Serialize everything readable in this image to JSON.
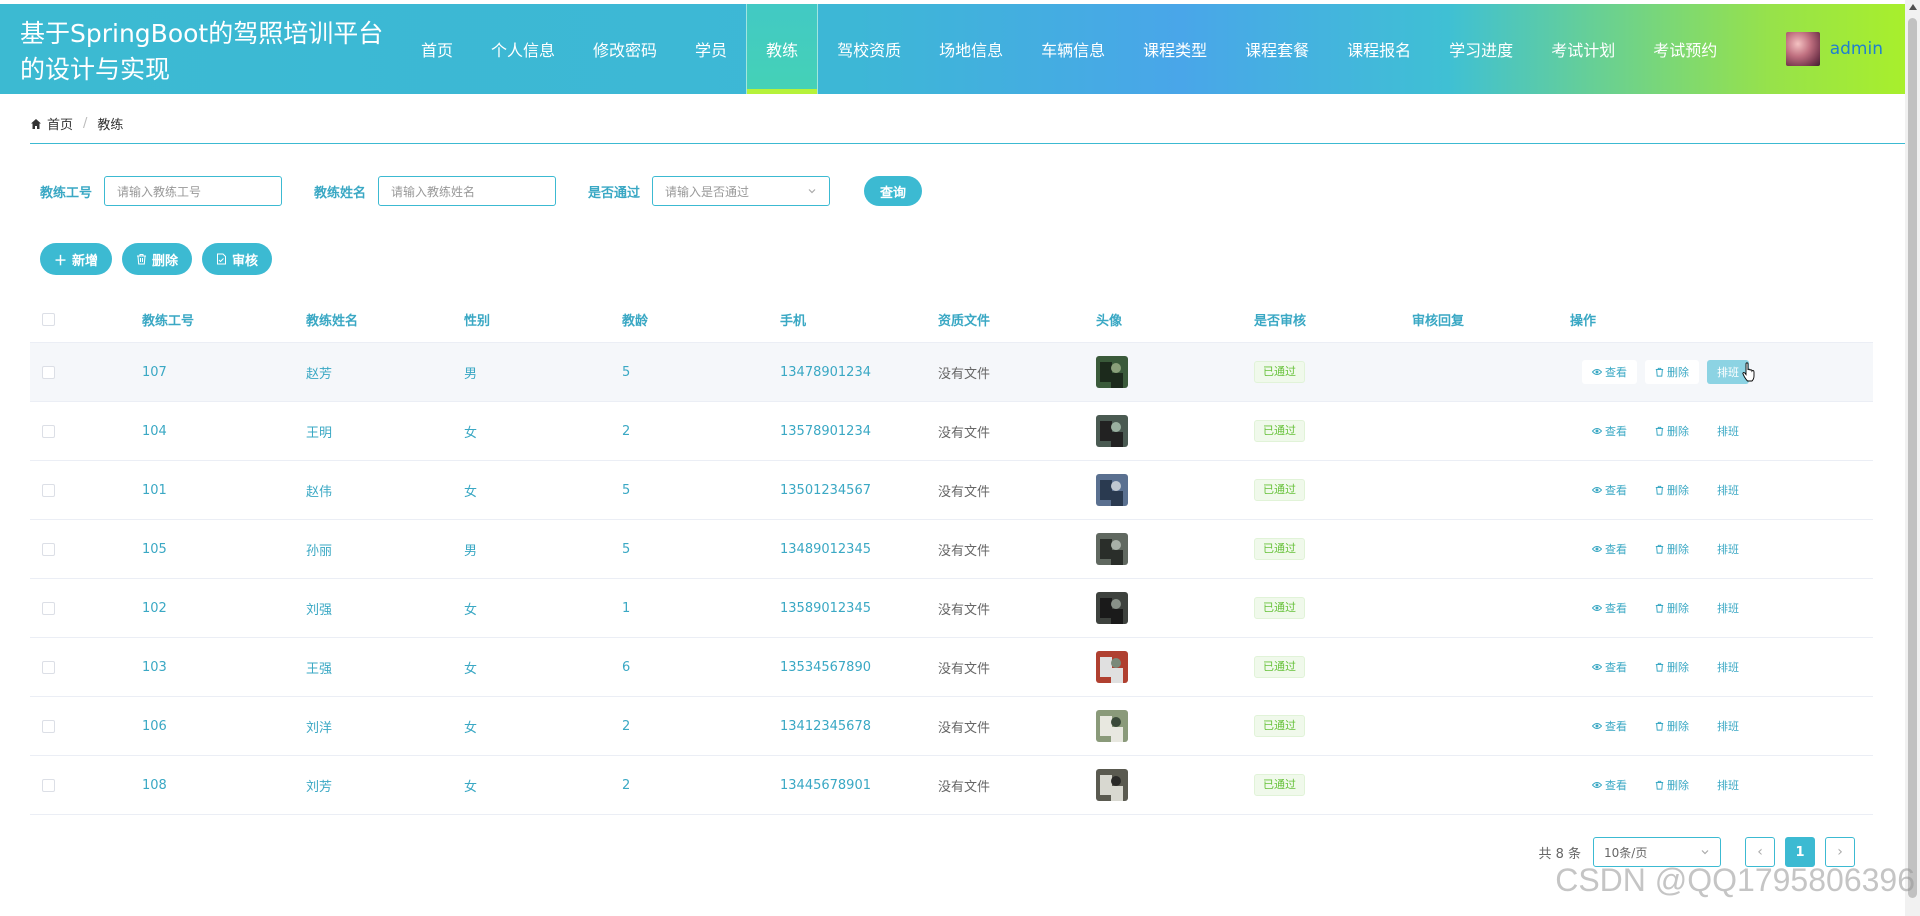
{
  "header": {
    "title": "基于SpringBoot的驾照培训平台的设计与实现",
    "nav": [
      {
        "label": "首页",
        "active": false
      },
      {
        "label": "个人信息",
        "active": false
      },
      {
        "label": "修改密码",
        "active": false
      },
      {
        "label": "学员",
        "active": false
      },
      {
        "label": "教练",
        "active": true
      },
      {
        "label": "驾校资质",
        "active": false
      },
      {
        "label": "场地信息",
        "active": false
      },
      {
        "label": "车辆信息",
        "active": false
      },
      {
        "label": "课程类型",
        "active": false
      },
      {
        "label": "课程套餐",
        "active": false
      },
      {
        "label": "课程报名",
        "active": false
      },
      {
        "label": "学习进度",
        "active": false
      },
      {
        "label": "考试计划",
        "active": false
      },
      {
        "label": "考试预约",
        "active": false
      }
    ],
    "username": "admin"
  },
  "breadcrumb": {
    "home": "首页",
    "current": "教练"
  },
  "search": {
    "id_label": "教练工号",
    "id_placeholder": "请输入教练工号",
    "name_label": "教练姓名",
    "name_placeholder": "请输入教练姓名",
    "pass_label": "是否通过",
    "pass_placeholder": "请输入是否通过",
    "query": "查询"
  },
  "actions": {
    "add": "新增",
    "delete": "删除",
    "audit": "审核"
  },
  "table": {
    "headers": [
      "教练工号",
      "教练姓名",
      "性别",
      "教龄",
      "手机",
      "资质文件",
      "头像",
      "是否审核",
      "审核回复",
      "操作"
    ],
    "rows": [
      {
        "id": "107",
        "name": "赵芳",
        "sex": "男",
        "age": "5",
        "phone": "13478901234",
        "file": "没有文件",
        "status": "已通过",
        "reply": ""
      },
      {
        "id": "104",
        "name": "王明",
        "sex": "女",
        "age": "2",
        "phone": "13578901234",
        "file": "没有文件",
        "status": "已通过",
        "reply": ""
      },
      {
        "id": "101",
        "name": "赵伟",
        "sex": "女",
        "age": "5",
        "phone": "13501234567",
        "file": "没有文件",
        "status": "已通过",
        "reply": ""
      },
      {
        "id": "105",
        "name": "孙丽",
        "sex": "男",
        "age": "5",
        "phone": "13489012345",
        "file": "没有文件",
        "status": "已通过",
        "reply": ""
      },
      {
        "id": "102",
        "name": "刘强",
        "sex": "女",
        "age": "1",
        "phone": "13589012345",
        "file": "没有文件",
        "status": "已通过",
        "reply": ""
      },
      {
        "id": "103",
        "name": "王强",
        "sex": "女",
        "age": "6",
        "phone": "13534567890",
        "file": "没有文件",
        "status": "已通过",
        "reply": ""
      },
      {
        "id": "106",
        "name": "刘洋",
        "sex": "女",
        "age": "2",
        "phone": "13412345678",
        "file": "没有文件",
        "status": "已通过",
        "reply": ""
      },
      {
        "id": "108",
        "name": "刘芳",
        "sex": "女",
        "age": "2",
        "phone": "13445678901",
        "file": "没有文件",
        "status": "已通过",
        "reply": ""
      }
    ],
    "ops": {
      "view": "查看",
      "delete": "删除",
      "schedule": "排班"
    }
  },
  "pager": {
    "total": "共 8 条",
    "size": "10条/页",
    "current": "1",
    "prev": "‹",
    "next": "›"
  },
  "watermark": "CSDN @QQ1795806396",
  "colors": {
    "accent": "#3cbad2",
    "success": "#67c23a",
    "text_accent": "#3aa8c4"
  }
}
